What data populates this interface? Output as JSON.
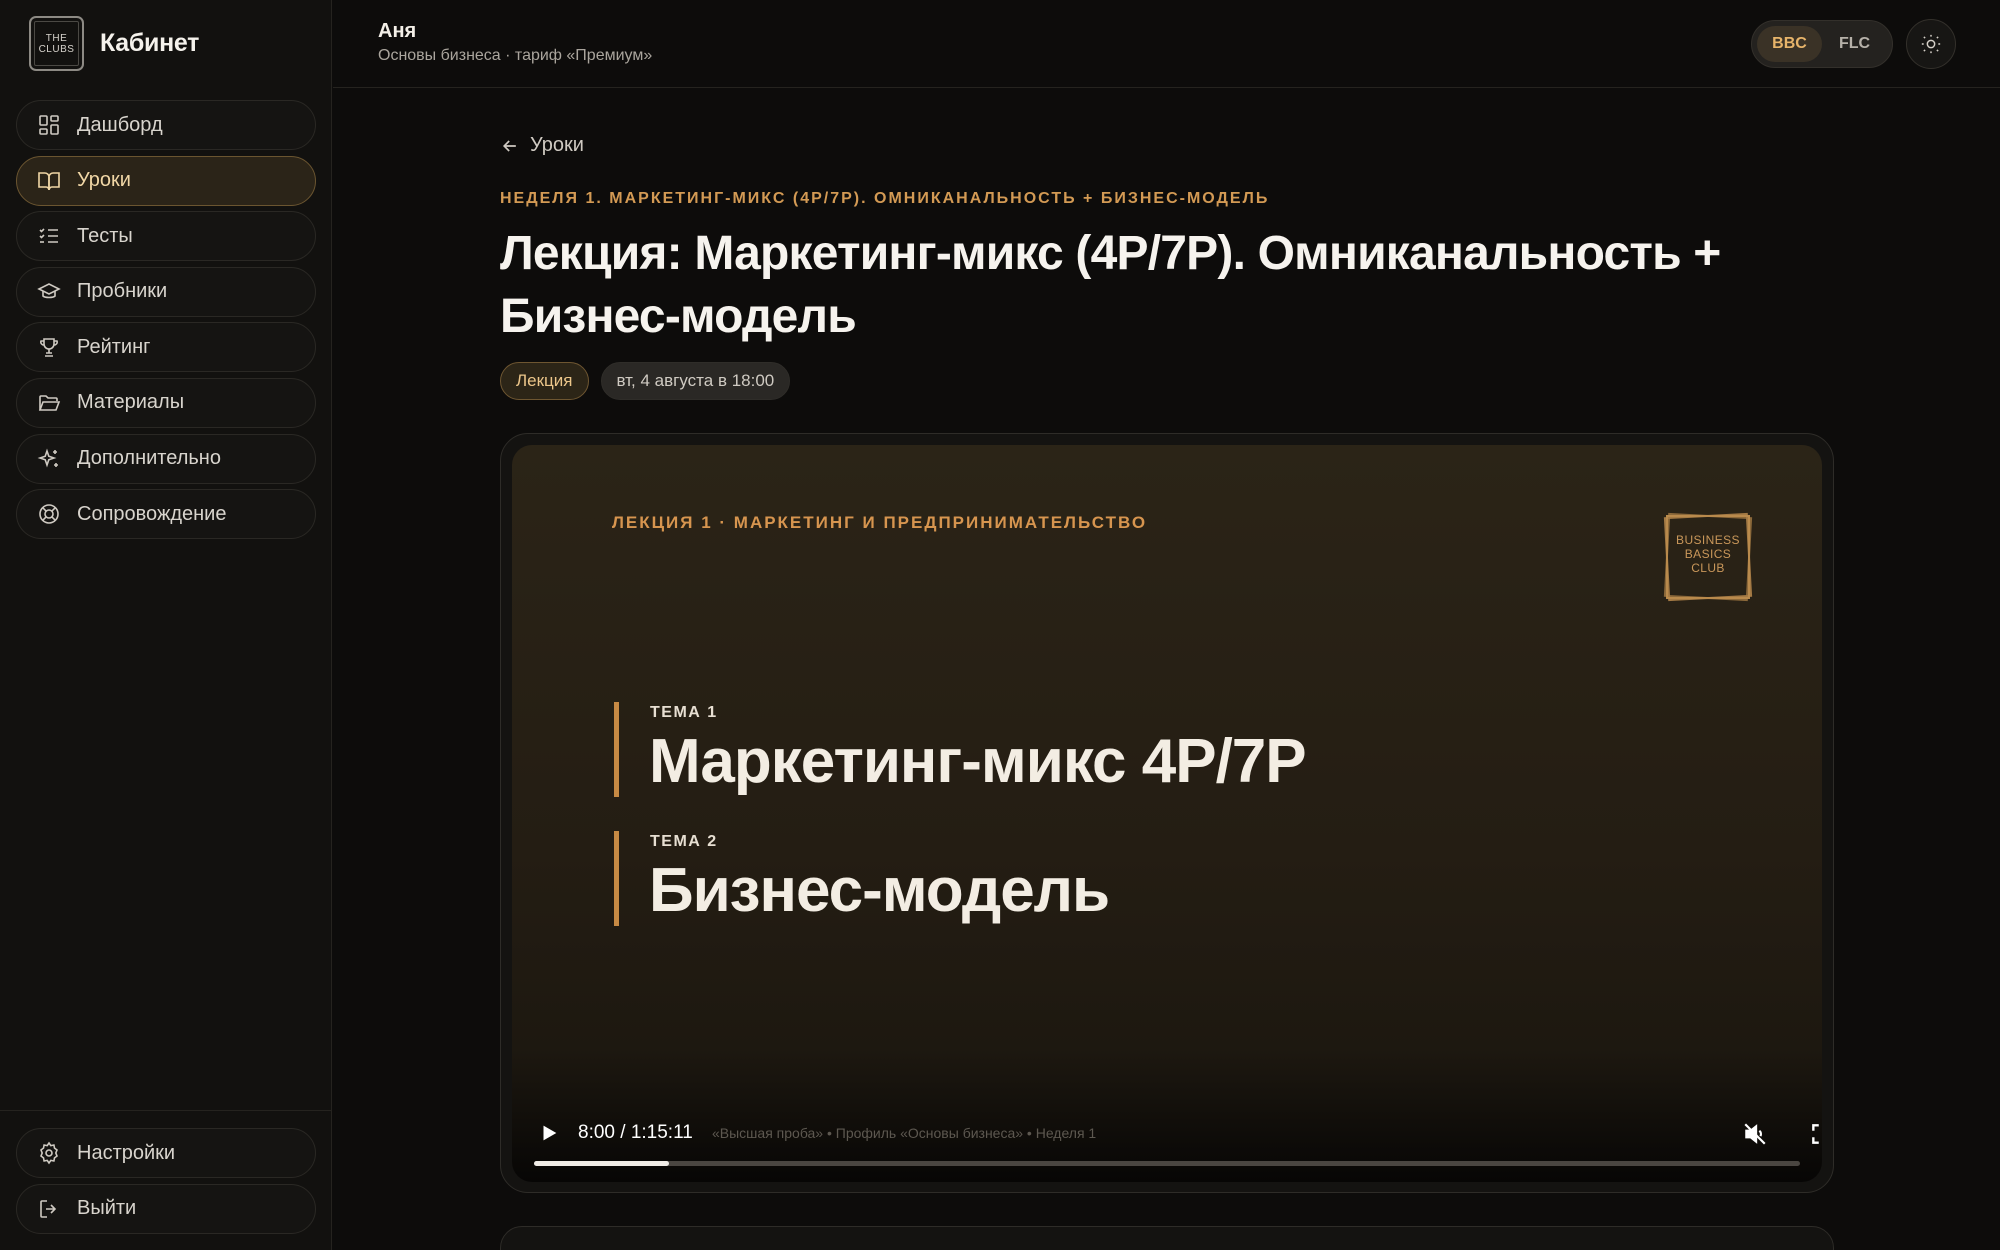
{
  "sidebar": {
    "logo_lines": [
      "THE",
      "CLUBS"
    ],
    "title": "Кабинет",
    "items": [
      {
        "label": "Дашборд",
        "icon": "dashboard-icon"
      },
      {
        "label": "Уроки",
        "icon": "book-icon",
        "active": true
      },
      {
        "label": "Тесты",
        "icon": "checklist-icon"
      },
      {
        "label": "Пробники",
        "icon": "graduation-cap-icon"
      },
      {
        "label": "Рейтинг",
        "icon": "trophy-icon"
      },
      {
        "label": "Материалы",
        "icon": "folder-icon"
      },
      {
        "label": "Дополнительно",
        "icon": "sparkles-icon"
      },
      {
        "label": "Сопровождение",
        "icon": "lifebuoy-icon"
      }
    ],
    "bottom_items": [
      {
        "label": "Настройки",
        "icon": "gear-icon"
      },
      {
        "label": "Выйти",
        "icon": "logout-icon"
      }
    ]
  },
  "header": {
    "user_name": "Аня",
    "user_subtitle": "Основы бизнеса · тариф «Премиум»",
    "switch": [
      "BBC",
      "FLC"
    ],
    "switch_active": "BBC"
  },
  "lesson": {
    "back_label": "Уроки",
    "week_label": "НЕДЕЛЯ 1. МАРКЕТИНГ-МИКС (4P/7P). ОМНИКАНАЛЬНОСТЬ + БИЗНЕС-МОДЕЛЬ",
    "title": "Лекция: Маркетинг-микс (4P/7P). Омниканальность + Бизнес-модель",
    "kind_badge": "Лекция",
    "date_badge": "вт, 4 августа в 18:00"
  },
  "video": {
    "slide_header": "ЛЕКЦИЯ 1 · МАРКЕТИНГ И ПРЕДПРИНИМАТЕЛЬСТВО",
    "logo_lines": [
      "BUSINESS",
      "BASICS",
      "CLUB"
    ],
    "topics": [
      {
        "label": "ТЕМА 1",
        "name": "Маркетинг-микс 4P/7P"
      },
      {
        "label": "ТЕМА 2",
        "name": "Бизнес-модель"
      }
    ],
    "time": "8:00 / 1:15:11",
    "ghost_caption": "«Высшая проба»   •   Профиль «Основы бизнеса»   •   Неделя 1",
    "progress": 0.107
  },
  "colors": {
    "accent": "#d39a54",
    "active_nav_bg": "#2b2418",
    "background": "#0d0c0b"
  }
}
